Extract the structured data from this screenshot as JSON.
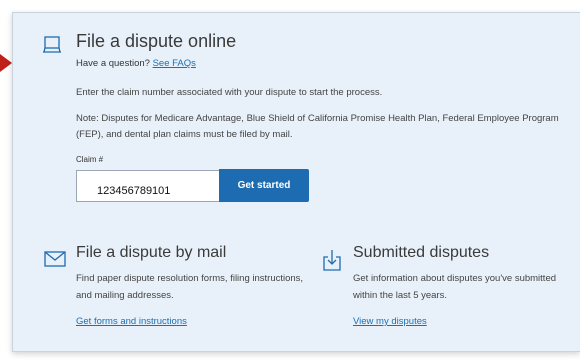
{
  "online": {
    "title": "File a dispute online",
    "question_text": "Have a question? ",
    "faq_link": "See FAQs",
    "instruction": "Enter the claim number associated with your dispute to start the process.",
    "note": "Note: Disputes for Medicare Advantage, Blue Shield of California Promise Health Plan, Federal Employee Program (FEP), and dental plan claims must be filed by mail.",
    "claim_label": "Claim #",
    "claim_value": "123456789101",
    "start_button": "Get started"
  },
  "mail": {
    "title": "File a dispute by mail",
    "description": "Find paper dispute resolution forms, filing instructions, and mailing addresses.",
    "link": "Get forms and instructions"
  },
  "submitted": {
    "title": "Submitted disputes",
    "description": "Get information about disputes you've submitted within the last 5 years.",
    "link": "View my disputes"
  },
  "icons": {
    "online": "laptop-icon",
    "mail": "envelope-icon",
    "submitted": "download-icon",
    "pointer": "red-arrow-pointer"
  },
  "colors": {
    "panel_bg": "#e8f1f9",
    "button_bg": "#1d6bb0",
    "link": "#1a6fb5",
    "pointer": "#c0201a"
  }
}
